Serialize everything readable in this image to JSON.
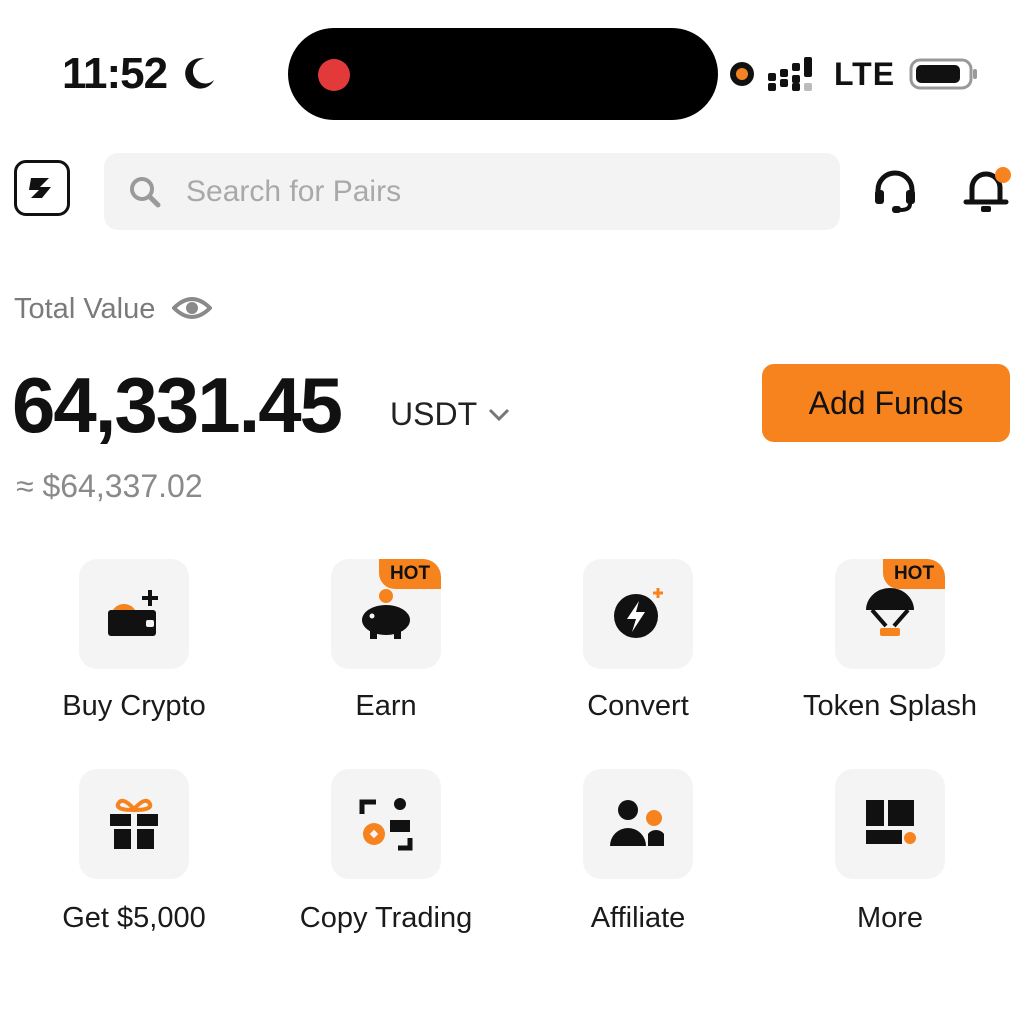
{
  "status_bar": {
    "time": "11:52",
    "network": "LTE",
    "icons": [
      "moon-icon",
      "recording-dot",
      "dynamic-island",
      "camera-in-use-indicator",
      "signal-bars-icon",
      "battery-icon"
    ]
  },
  "header": {
    "logo_icon": "bitget-logo-icon",
    "search_placeholder": "Search for Pairs",
    "icons": [
      "search-icon",
      "headset-support-icon",
      "bell-notification-icon"
    ]
  },
  "balance": {
    "label": "Total Value",
    "amount": "64,331.45",
    "currency": "USDT",
    "approx": "≈ $64,337.02",
    "add_funds_label": "Add Funds"
  },
  "colors": {
    "accent": "#f7831e",
    "tile_bg": "#f4f4f4",
    "search_bg": "#f3f3f3",
    "text": "#111111",
    "muted": "#8a8a8a"
  },
  "shortcuts": [
    {
      "label": "Buy Crypto",
      "icon": "wallet-plus-icon",
      "badge": ""
    },
    {
      "label": "Earn",
      "icon": "piggy-bank-icon",
      "badge": "HOT"
    },
    {
      "label": "Convert",
      "icon": "lightning-convert-icon",
      "badge": ""
    },
    {
      "label": "Token Splash",
      "icon": "parachute-icon",
      "badge": "HOT"
    },
    {
      "label": "Get $5,000",
      "icon": "gift-icon",
      "badge": ""
    },
    {
      "label": "Copy Trading",
      "icon": "copy-trading-icon",
      "badge": ""
    },
    {
      "label": "Affiliate",
      "icon": "affiliate-users-icon",
      "badge": ""
    },
    {
      "label": "More",
      "icon": "more-grid-icon",
      "badge": ""
    }
  ]
}
